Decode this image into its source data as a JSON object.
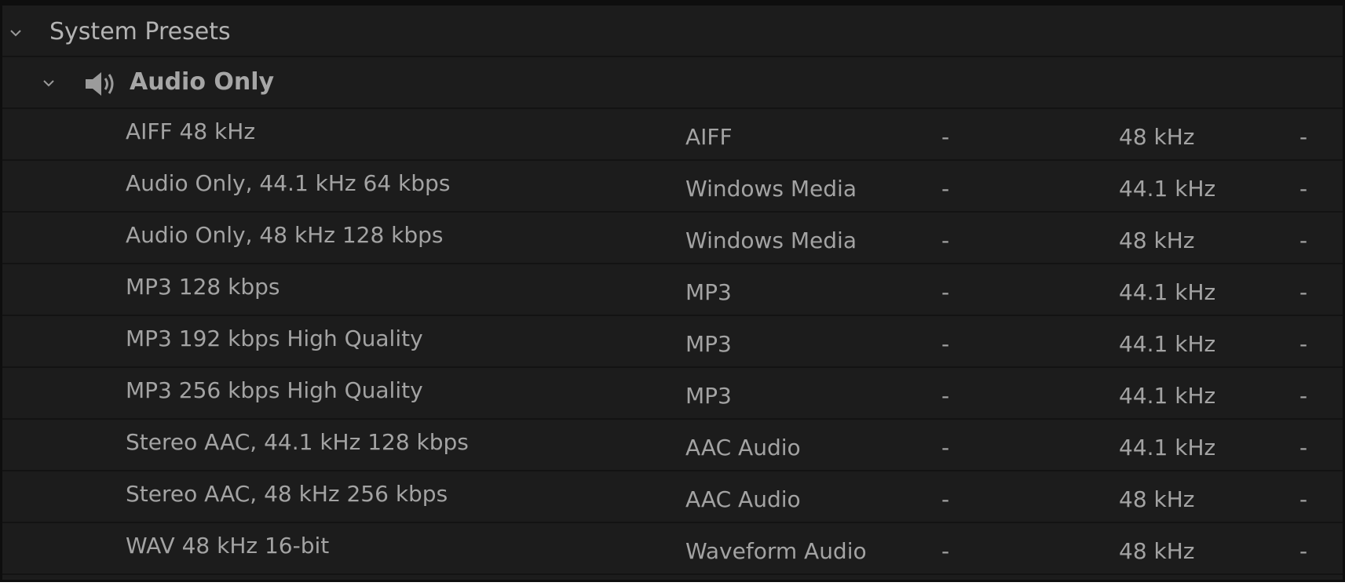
{
  "tree": {
    "root": {
      "label": "System Presets",
      "expanded": true
    },
    "group": {
      "label": "Audio Only",
      "icon": "speaker-icon",
      "expanded": true
    },
    "presets": [
      {
        "name": "AIFF 48 kHz",
        "format": "AIFF",
        "col3": "-",
        "sample_rate": "48 kHz",
        "col5": "-"
      },
      {
        "name": "Audio Only, 44.1 kHz 64 kbps",
        "format": "Windows Media",
        "col3": "-",
        "sample_rate": "44.1 kHz",
        "col5": "-"
      },
      {
        "name": "Audio Only, 48 kHz 128 kbps",
        "format": "Windows Media",
        "col3": "-",
        "sample_rate": "48 kHz",
        "col5": "-"
      },
      {
        "name": "MP3 128 kbps",
        "format": "MP3",
        "col3": "-",
        "sample_rate": "44.1 kHz",
        "col5": "-"
      },
      {
        "name": "MP3 192 kbps High Quality",
        "format": "MP3",
        "col3": "-",
        "sample_rate": "44.1 kHz",
        "col5": "-"
      },
      {
        "name": "MP3 256 kbps High Quality",
        "format": "MP3",
        "col3": "-",
        "sample_rate": "44.1 kHz",
        "col5": "-"
      },
      {
        "name": "Stereo AAC, 44.1 kHz 128 kbps",
        "format": "AAC Audio",
        "col3": "-",
        "sample_rate": "44.1 kHz",
        "col5": "-"
      },
      {
        "name": "Stereo AAC, 48 kHz 256 kbps",
        "format": "AAC Audio",
        "col3": "-",
        "sample_rate": "48 kHz",
        "col5": "-"
      },
      {
        "name": "WAV 48 kHz 16-bit",
        "format": "Waveform Audio",
        "col3": "-",
        "sample_rate": "48 kHz",
        "col5": "-"
      }
    ]
  },
  "colors": {
    "panel_bg": "#1c1c1c",
    "text": "#a3a3a3",
    "separator": "#131313"
  }
}
